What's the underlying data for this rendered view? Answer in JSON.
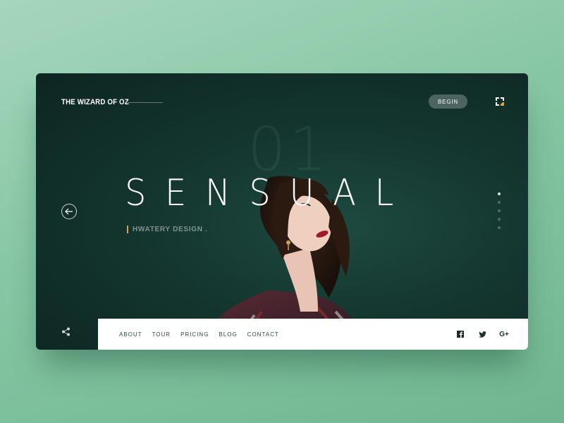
{
  "header": {
    "brand": "THE WIZARD OF OZ",
    "begin_label": "BEGIN"
  },
  "hero": {
    "slide_number": "01",
    "title": "SENSUAL",
    "subtitle": "HWATERY DESIGN ."
  },
  "slider": {
    "dots": 5,
    "active_index": 0
  },
  "nav": {
    "items": [
      "ABOUT",
      "TOUR",
      "PRICING",
      "BLOG",
      "CONTACT"
    ]
  },
  "social": {
    "facebook": "facebook-icon",
    "twitter": "twitter-icon",
    "google_plus_label": "G+"
  },
  "icons": {
    "back": "arrow-left-icon",
    "share": "share-icon",
    "logo": "logo-icon"
  },
  "colors": {
    "accent": "#d9a34a",
    "card": "#14362f",
    "background": "#86c6a4"
  }
}
